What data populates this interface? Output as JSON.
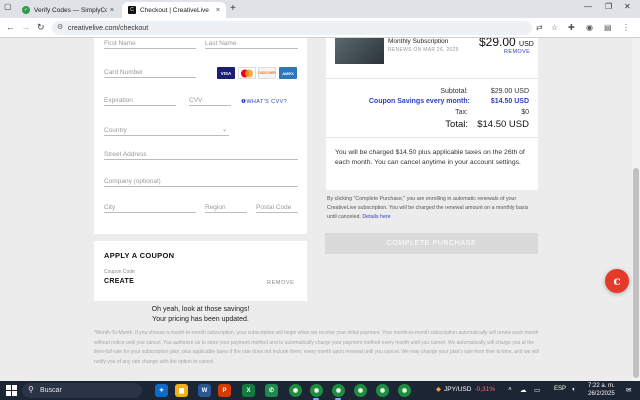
{
  "browser": {
    "tabs": [
      {
        "title": "Verify Codes — SimplyCodes",
        "icon": "simplycodes-favicon",
        "active": false
      },
      {
        "title": "Checkout | CreativeLive",
        "icon": "creativelive-favicon",
        "active": true
      }
    ],
    "url": "creativelive.com/checkout",
    "new_tab": "+",
    "close": "×"
  },
  "form": {
    "first_name": "First Name",
    "last_name": "Last Name",
    "card_number": "Card Number",
    "cards": [
      "VISA",
      "MC",
      "DISCOVER",
      "AMEX"
    ],
    "expiration": "Expiration",
    "cvv": "CVV",
    "whats_cvv": "WHAT'S CVV?",
    "country": "Country",
    "street": "Street Address",
    "company": "Company (optional)",
    "city": "City",
    "region": "Region",
    "postal": "Postal Code"
  },
  "coupon": {
    "heading": "APPLY A COUPON",
    "code_label": "Coupon Code",
    "code": "CREATE",
    "remove": "REMOVE"
  },
  "savings_msg": {
    "line1": "Oh yeah, look at those savings!",
    "line2": "Your pricing has been updated."
  },
  "order": {
    "product": "Monthly Subscription",
    "renews": "RENEWS ON MAR 26, 2025",
    "price": "$29.00",
    "currency": "USD",
    "remove": "REMOVE",
    "subtotal_label": "Subtotal:",
    "subtotal": "$29.00 USD",
    "savings_label": "Coupon Savings every month:",
    "savings": "$14.50 USD",
    "tax_label": "Tax:",
    "tax": "$0",
    "total_label": "Total:",
    "total": "$14.50 USD",
    "charge_note": "You will be charged $14.50 plus applicable taxes on the 26th of each month. You can cancel anytime in your account settings.",
    "terms": "By clicking \"Complete Purchase,\" you are enrolling in automatic renewals of your CreativeLive subscription. You will be charged the renewal amount on a monthly basis until canceled.",
    "terms_link": "Details here",
    "purchase_button": "COMPLETE PURCHASE"
  },
  "footnote": "*Month-To-Month. If you choose a month-to-month subscription, your subscription will begin when we receive your initial payment. Your month-to-month subscription automatically will renew each month without notice until you cancel. You authorize us to store your payment method and to automatically charge your payment method every month until you cancel. We automatically will charge you at the then-full-rate for your subscription plan, plus applicable taxes if the rate does not include them, every month upon renewal until you cancel. We may change your plan's rate from time to time, and we will notify you of any rate change with the option to cancel.",
  "chat_icon_letter": "c",
  "taskbar": {
    "search": "Buscar",
    "ticker_name": "JPY/USD",
    "ticker_change": "-0,31%",
    "lang": "ESP",
    "time": "7:22 a. m.",
    "date": "26/2/2025"
  },
  "colors": {
    "accent": "#2d3ec2",
    "chat": "#e5392a"
  }
}
